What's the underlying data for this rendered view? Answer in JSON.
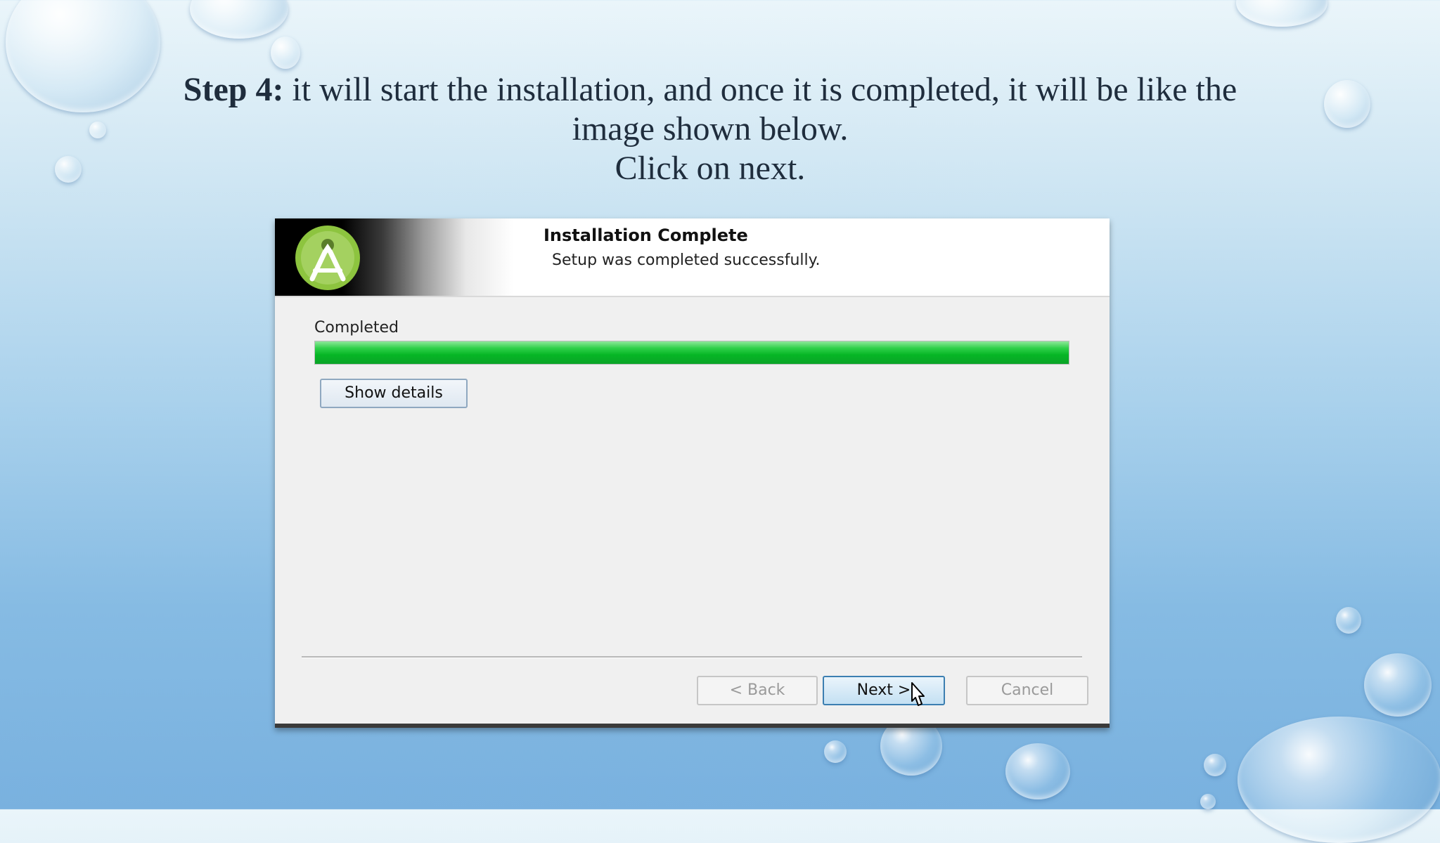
{
  "slide": {
    "title_bold": "Step 4:",
    "title_rest": " it will start the installation, and once it is completed, it will be like the",
    "title_line2": "image shown below.",
    "title_line3": "Click on next."
  },
  "installer": {
    "header_title": "Installation Complete",
    "header_subtitle": "Setup was completed successfully.",
    "status_label": "Completed",
    "progress_percent": 100,
    "show_details_label": "Show details",
    "back_label": "< Back",
    "next_label": "Next >",
    "cancel_label": "Cancel",
    "logo_icon": "android-studio-icon",
    "progress_color": "#06b625"
  }
}
